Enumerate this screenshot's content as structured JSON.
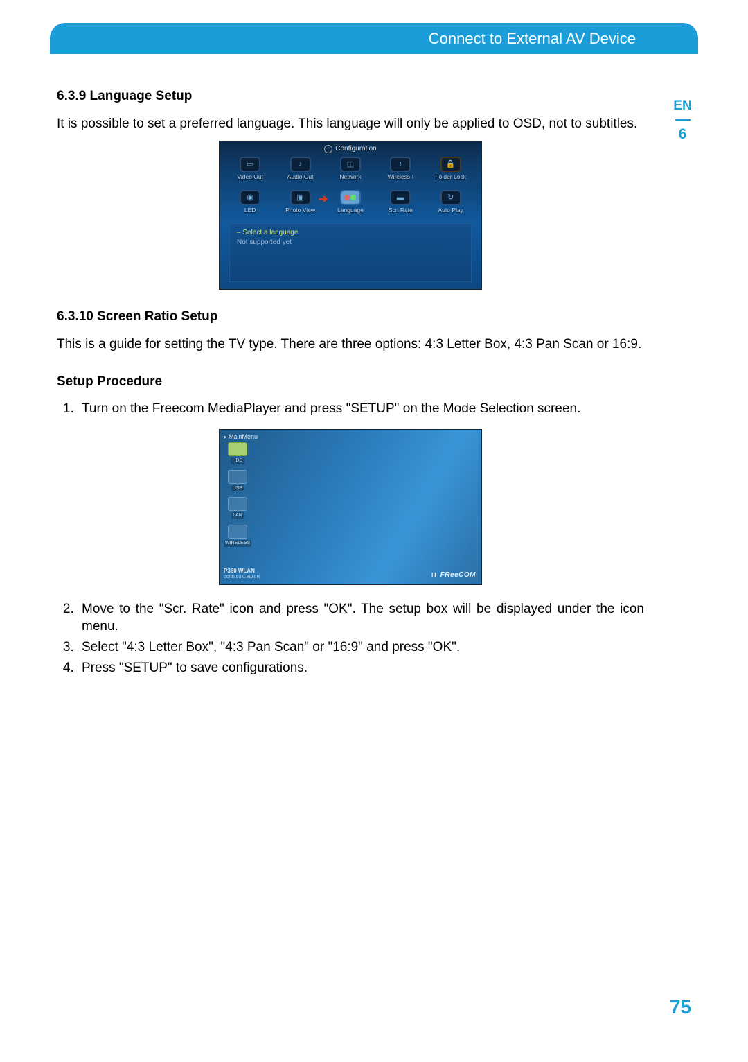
{
  "header": {
    "title": "Connect to External AV Device"
  },
  "sidetab": {
    "lang": "EN",
    "chapter": "6"
  },
  "page_number": "75",
  "sections": {
    "s1": {
      "heading": "6.3.9 Language Setup",
      "body": "It is possible to set a preferred language. This language will only be applied to OSD, not to subtitles."
    },
    "s2": {
      "heading": "6.3.10 Screen Ratio Setup",
      "body": "This is a guide for setting the TV type. There are three options: 4:3 Letter Box, 4:3 Pan Scan or 16:9."
    },
    "proc": {
      "heading": "Setup Procedure",
      "items": [
        "Turn on the Freecom MediaPlayer and press \"SETUP\" on the Mode Selection screen.",
        "Move to the \"Scr. Rate\" icon and press \"OK\".  The setup box will be displayed under the icon menu.",
        "Select \"4:3 Letter Box\", \"4:3 Pan Scan\" or \"16:9\" and press \"OK\".",
        "Press \"SETUP\" to save configurations."
      ]
    }
  },
  "shot1": {
    "title": "Configuration",
    "row1": [
      "Video Out",
      "Audio Out",
      "Network",
      "Wireless-I",
      "Folder Lock"
    ],
    "row2": [
      "LED",
      "Photo View",
      "Language",
      "Scr. Rate",
      "Auto Play"
    ],
    "panel_l1": "– Select a language",
    "panel_l2": "Not supported yet"
  },
  "shot2": {
    "title": "MainMenu",
    "items": [
      "HDD",
      "USB",
      "LAN",
      "WIRELESS"
    ],
    "model": "P360 WLAN",
    "model_sub": "CORD DUAL ALARM",
    "brand": "FReeCOM"
  }
}
